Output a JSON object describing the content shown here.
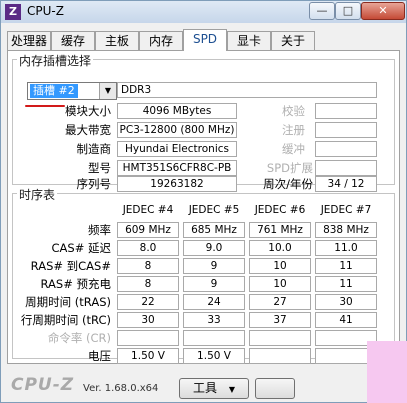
{
  "window": {
    "title": "CPU-Z",
    "icon_text": "Z",
    "min": "—",
    "max": "□",
    "close": "✕"
  },
  "tabs": [
    "处理器",
    "缓存",
    "主板",
    "内存",
    "SPD",
    "显卡",
    "关于"
  ],
  "active_tab": "SPD",
  "slot_section": {
    "legend": "内存插槽选择",
    "slot_value": "插槽 #2",
    "memory_type": "DDR3",
    "labels": {
      "module_size": "模块大小",
      "max_bandwidth": "最大带宽",
      "manufacturer": "制造商",
      "part_number": "型号",
      "serial_number": "序列号",
      "correction": "校验",
      "registered": "注册",
      "buffered": "缓冲",
      "spd_ext": "SPD扩展",
      "week_year": "周次/年份"
    },
    "values": {
      "module_size": "4096 MBytes",
      "max_bandwidth": "PC3-12800 (800 MHz)",
      "manufacturer": "Hyundai Electronics",
      "part_number": "HMT351S6CFR8C-PB",
      "serial_number": "19263182",
      "week_year": "34 / 12"
    }
  },
  "timings": {
    "legend": "时序表",
    "columns": [
      "JEDEC #4",
      "JEDEC #5",
      "JEDEC #6",
      "JEDEC #7"
    ],
    "rows": [
      {
        "label": "频率",
        "values": [
          "609 MHz",
          "685 MHz",
          "761 MHz",
          "838 MHz"
        ]
      },
      {
        "label": "CAS# 延迟",
        "values": [
          "8.0",
          "9.0",
          "10.0",
          "11.0"
        ]
      },
      {
        "label": "RAS# 到CAS#",
        "values": [
          "8",
          "9",
          "10",
          "11"
        ]
      },
      {
        "label": "RAS# 预充电",
        "values": [
          "8",
          "9",
          "10",
          "11"
        ]
      },
      {
        "label": "周期时间 (tRAS)",
        "values": [
          "22",
          "24",
          "27",
          "30"
        ]
      },
      {
        "label": "行周期时间 (tRC)",
        "values": [
          "30",
          "33",
          "37",
          "41"
        ]
      },
      {
        "label": "命令率 (CR)",
        "values": [
          "",
          "",
          "",
          ""
        ]
      },
      {
        "label": "电压",
        "values": [
          "1.50 V",
          "1.50 V",
          "",
          ""
        ]
      }
    ]
  },
  "footer": {
    "brand": "CPU-Z",
    "version": "Ver. 1.68.0.x64",
    "tools_button": "工具",
    "tools_arrow": "▼"
  }
}
